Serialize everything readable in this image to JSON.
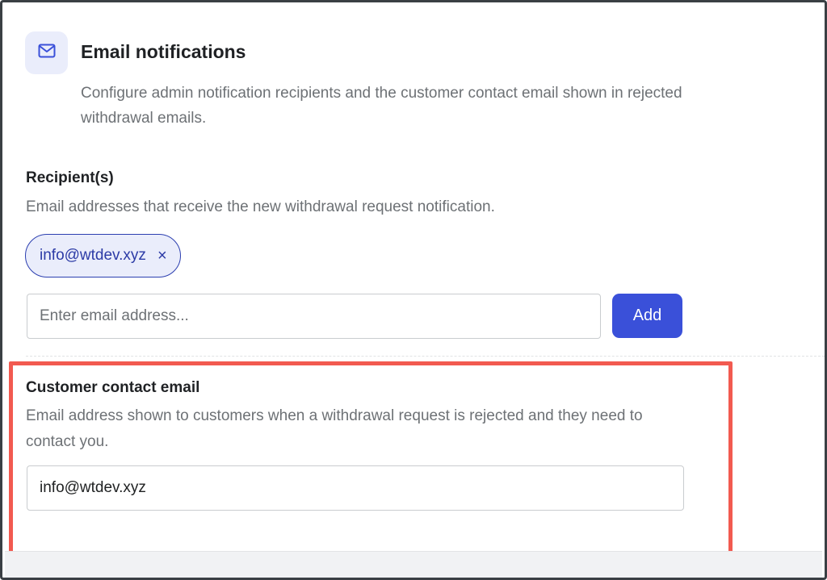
{
  "section": {
    "icon": "mail-icon",
    "title": "Email notifications",
    "description": "Configure admin notification recipients and the customer contact email shown in rejected withdrawal emails."
  },
  "recipients": {
    "label": "Recipient(s)",
    "help": "Email addresses that receive the new withdrawal request notification.",
    "chips": [
      {
        "email": "info@wtdev.xyz",
        "remove_icon": "close-icon",
        "remove_glyph": "×"
      }
    ],
    "input_placeholder": "Enter email address...",
    "input_value": "",
    "add_label": "Add"
  },
  "customer_contact": {
    "label": "Customer contact email",
    "help": "Email address shown to customers when a withdrawal request is rejected and they need to contact you.",
    "value": "info@wtdev.xyz"
  },
  "colors": {
    "accent": "#3a50d9",
    "chip_bg": "#eaedfb",
    "highlight": "#f25a50"
  }
}
